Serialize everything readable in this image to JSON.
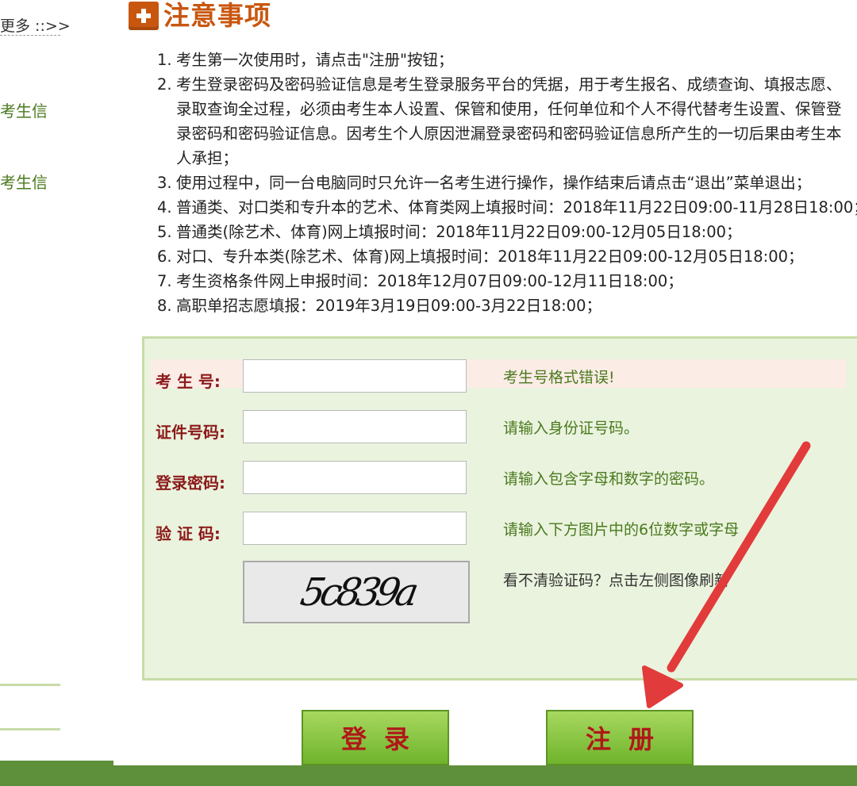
{
  "sidebar": {
    "more_link": "更多 ::>>",
    "items": [
      {
        "label": "考生信"
      },
      {
        "label": "考生信"
      }
    ]
  },
  "notice": {
    "icon": "plus-icon",
    "title": "注意事项",
    "items": [
      {
        "num": "1.",
        "lines": [
          "考生第一次使用时，请点击\"注册\"按钮；"
        ]
      },
      {
        "num": "2.",
        "lines": [
          "考生登录密码及密码验证信息是考生登录服务平台的凭据，用于考生报名、成绩查询、填报志愿、",
          "录取查询全过程，必须由考生本人设置、保管和使用，任何单位和个人不得代替考生设置、保管登",
          "录密码和密码验证信息。因考生个人原因泄漏登录密码和密码验证信息所产生的一切后果由考生本",
          "人承担；"
        ]
      },
      {
        "num": "3.",
        "lines": [
          "使用过程中，同一台电脑同时只允许一名考生进行操作，操作结束后请点击“退出”菜单退出；"
        ]
      },
      {
        "num": "4.",
        "lines": [
          "普通类、对口类和专升本的艺术、体育类网上填报时间：2018年11月22日09:00-11月28日18:00；"
        ]
      },
      {
        "num": "5.",
        "lines": [
          "普通类(除艺术、体育)网上填报时间：2018年11月22日09:00-12月05日18:00；"
        ]
      },
      {
        "num": "6.",
        "lines": [
          "对口、专升本类(除艺术、体育)网上填报时间：2018年11月22日09:00-12月05日18:00；"
        ]
      },
      {
        "num": "7.",
        "lines": [
          "考生资格条件网上申报时间：2018年12月07日09:00-12月11日18:00；"
        ]
      },
      {
        "num": "8.",
        "lines": [
          "高职单招志愿填报：2019年3月19日09:00-3月22日18:00；"
        ]
      }
    ]
  },
  "form": {
    "fields": [
      {
        "label": "考 生 号:",
        "value": "",
        "hint": "考生号格式错误!"
      },
      {
        "label": "证件号码:",
        "value": "",
        "hint": "请输入身份证号码。"
      },
      {
        "label": "登录密码:",
        "value": "",
        "hint": "请输入包含字母和数字的密码。"
      },
      {
        "label": "验 证 码:",
        "value": "",
        "hint": "请输入下方图片中的6位数字或字母"
      }
    ],
    "captcha_text": "5c839a",
    "captcha_hint": "看不清验证码？点击左侧图像刷新"
  },
  "buttons": {
    "login": "登录",
    "register": "注册"
  },
  "colors": {
    "accent": "#c8560f",
    "label": "#8b1a1a",
    "hint": "#4a7a1e",
    "button": "#7fc23a",
    "button_text": "#b01818",
    "panel": "#eaf3de",
    "arrow": "#e23b3b"
  }
}
